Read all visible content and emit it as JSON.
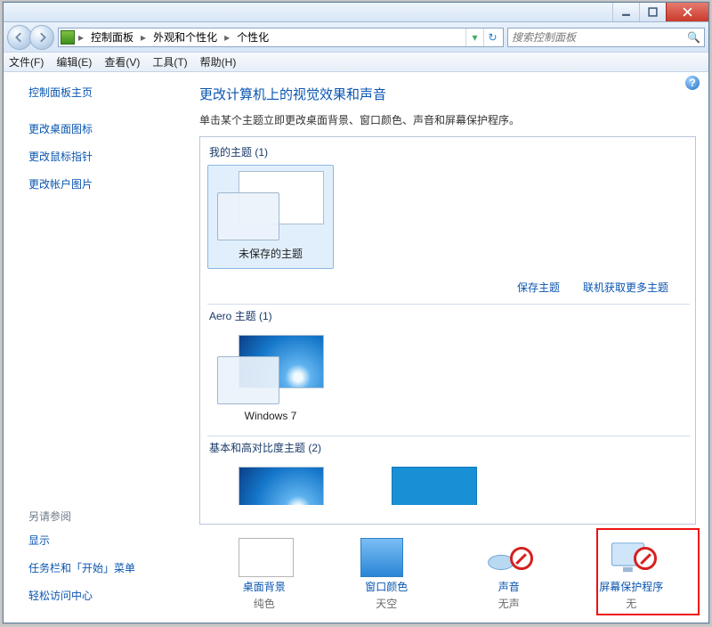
{
  "titlebar": {
    "min_tip": "Minimize",
    "max_tip": "Maximize",
    "close_tip": "Close"
  },
  "address": {
    "crumbs": [
      "控制面板",
      "外观和个性化",
      "个性化"
    ],
    "search_placeholder": "搜索控制面板"
  },
  "menubar": [
    "文件(F)",
    "编辑(E)",
    "查看(V)",
    "工具(T)",
    "帮助(H)"
  ],
  "sidebar": {
    "home": "控制面板主页",
    "links": [
      "更改桌面图标",
      "更改鼠标指针",
      "更改帐户图片"
    ],
    "see_also_header": "另请参阅",
    "see_also": [
      "显示",
      "任务栏和「开始」菜单",
      "轻松访问中心"
    ]
  },
  "main": {
    "heading": "更改计算机上的视觉效果和声音",
    "desc": "单击某个主题立即更改桌面背景、窗口颜色、声音和屏幕保护程序。",
    "groups": {
      "my_themes_label": "我的主题 (1)",
      "aero_label": "Aero 主题 (1)",
      "basic_label": "基本和高对比度主题 (2)"
    },
    "themes": {
      "unsaved": "未保存的主题",
      "windows7": "Windows 7"
    },
    "actions": {
      "save": "保存主题",
      "get_more": "联机获取更多主题"
    }
  },
  "bottom": {
    "bg": {
      "label": "桌面背景",
      "sub": "纯色"
    },
    "color": {
      "label": "窗口颜色",
      "sub": "天空"
    },
    "sound": {
      "label": "声音",
      "sub": "无声"
    },
    "ss": {
      "label": "屏幕保护程序",
      "sub": "无"
    }
  }
}
